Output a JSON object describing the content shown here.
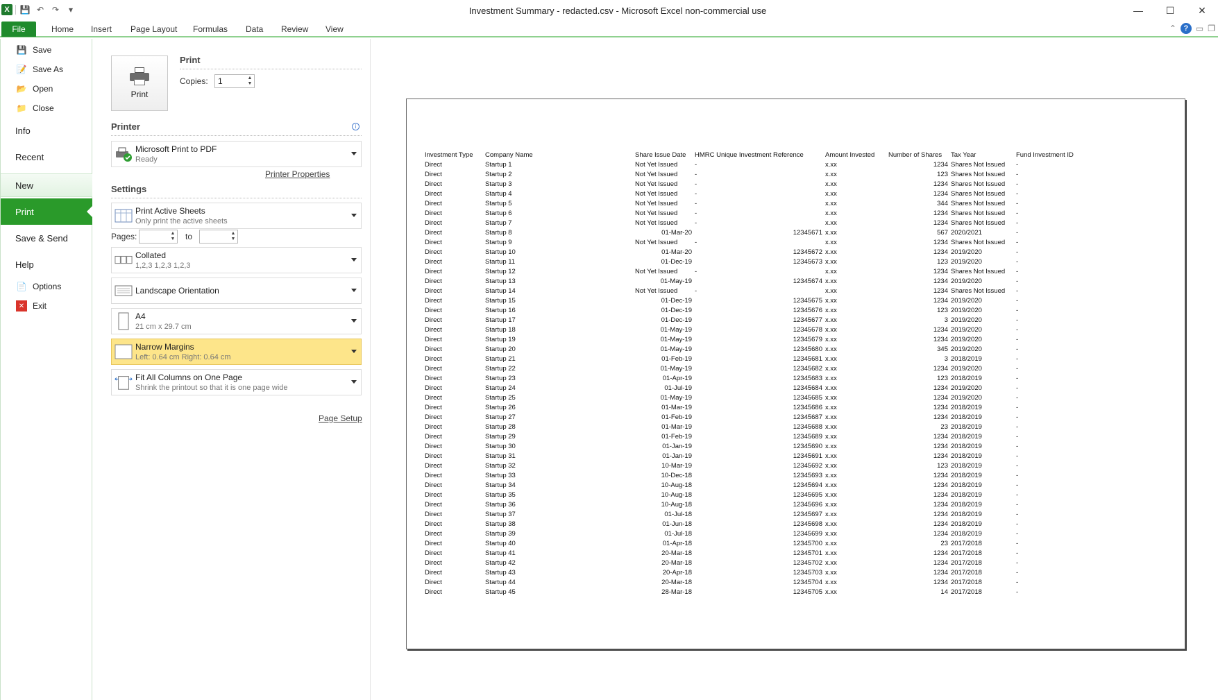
{
  "window": {
    "title": "Investment Summary - redacted.csv  -  Microsoft Excel non-commercial use"
  },
  "ribbon": {
    "tabs": [
      "File",
      "Home",
      "Insert",
      "Page Layout",
      "Formulas",
      "Data",
      "Review",
      "View"
    ]
  },
  "nav": {
    "save": "Save",
    "save_as": "Save As",
    "open": "Open",
    "close": "Close",
    "info": "Info",
    "recent": "Recent",
    "new": "New",
    "print": "Print",
    "save_send": "Save & Send",
    "help": "Help",
    "options": "Options",
    "exit": "Exit"
  },
  "print": {
    "heading": "Print",
    "button_label": "Print",
    "copies_label": "Copies:",
    "copies_value": "1",
    "printer_heading": "Printer",
    "printer_name": "Microsoft Print to PDF",
    "printer_status": "Ready",
    "printer_properties": "Printer Properties",
    "settings_heading": "Settings",
    "sheets_title": "Print Active Sheets",
    "sheets_sub": "Only print the active sheets",
    "pages_label": "Pages:",
    "pages_to": "to",
    "collated_title": "Collated",
    "collated_sub": "1,2,3    1,2,3    1,2,3",
    "orientation_title": "Landscape Orientation",
    "paper_title": "A4",
    "paper_sub": "21 cm x 29.7 cm",
    "margins_title": "Narrow Margins",
    "margins_sub": "Left:  0.64 cm    Right:  0.64 cm",
    "scaling_title": "Fit All Columns on One Page",
    "scaling_sub": "Shrink the printout so that it is one page wide",
    "page_setup": "Page Setup"
  },
  "sheet": {
    "headers": [
      "Investment Type",
      "Company Name",
      "Share Issue Date",
      "HMRC Unique Investment Reference",
      "Amount Invested",
      "Number of Shares",
      "Tax Year",
      "Fund Investment ID"
    ],
    "rows": [
      [
        "Direct",
        "Startup 1",
        "Not Yet Issued",
        "-",
        "",
        "x.xx",
        "1234",
        "Shares Not Issued",
        "-"
      ],
      [
        "Direct",
        "Startup 2",
        "Not Yet Issued",
        "-",
        "",
        "x.xx",
        "123",
        "Shares Not Issued",
        "-"
      ],
      [
        "Direct",
        "Startup 3",
        "Not Yet Issued",
        "-",
        "",
        "x.xx",
        "1234",
        "Shares Not Issued",
        "-"
      ],
      [
        "Direct",
        "Startup 4",
        "Not Yet Issued",
        "-",
        "",
        "x.xx",
        "1234",
        "Shares Not Issued",
        "-"
      ],
      [
        "Direct",
        "Startup 5",
        "Not Yet Issued",
        "-",
        "",
        "x.xx",
        "344",
        "Shares Not Issued",
        "-"
      ],
      [
        "Direct",
        "Startup 6",
        "Not Yet Issued",
        "-",
        "",
        "x.xx",
        "1234",
        "Shares Not Issued",
        "-"
      ],
      [
        "Direct",
        "Startup 7",
        "Not Yet Issued",
        "-",
        "",
        "x.xx",
        "1234",
        "Shares Not Issued",
        "-"
      ],
      [
        "Direct",
        "Startup 8",
        "01-Mar-20",
        "",
        "12345671",
        "x.xx",
        "567",
        "2020/2021",
        "-"
      ],
      [
        "Direct",
        "Startup 9",
        "Not Yet Issued",
        "-",
        "",
        "x.xx",
        "1234",
        "Shares Not Issued",
        "-"
      ],
      [
        "Direct",
        "Startup 10",
        "01-Mar-20",
        "",
        "12345672",
        "x.xx",
        "1234",
        "2019/2020",
        "-"
      ],
      [
        "Direct",
        "Startup 11",
        "01-Dec-19",
        "",
        "12345673",
        "x.xx",
        "123",
        "2019/2020",
        "-"
      ],
      [
        "Direct",
        "Startup 12",
        "Not Yet Issued",
        "-",
        "",
        "x.xx",
        "1234",
        "Shares Not Issued",
        "-"
      ],
      [
        "Direct",
        "Startup 13",
        "01-May-19",
        "",
        "12345674",
        "x.xx",
        "1234",
        "2019/2020",
        "-"
      ],
      [
        "Direct",
        "Startup 14",
        "Not Yet Issued",
        "-",
        "",
        "x.xx",
        "1234",
        "Shares Not Issued",
        "-"
      ],
      [
        "Direct",
        "Startup 15",
        "01-Dec-19",
        "",
        "12345675",
        "x.xx",
        "1234",
        "2019/2020",
        "-"
      ],
      [
        "Direct",
        "Startup 16",
        "01-Dec-19",
        "",
        "12345676",
        "x.xx",
        "123",
        "2019/2020",
        "-"
      ],
      [
        "Direct",
        "Startup 17",
        "01-Dec-19",
        "",
        "12345677",
        "x.xx",
        "3",
        "2019/2020",
        "-"
      ],
      [
        "Direct",
        "Startup 18",
        "01-May-19",
        "",
        "12345678",
        "x.xx",
        "1234",
        "2019/2020",
        "-"
      ],
      [
        "Direct",
        "Startup 19",
        "01-May-19",
        "",
        "12345679",
        "x.xx",
        "1234",
        "2019/2020",
        "-"
      ],
      [
        "Direct",
        "Startup 20",
        "01-May-19",
        "",
        "12345680",
        "x.xx",
        "345",
        "2019/2020",
        "-"
      ],
      [
        "Direct",
        "Startup 21",
        "01-Feb-19",
        "",
        "12345681",
        "x.xx",
        "3",
        "2018/2019",
        "-"
      ],
      [
        "Direct",
        "Startup 22",
        "01-May-19",
        "",
        "12345682",
        "x.xx",
        "1234",
        "2019/2020",
        "-"
      ],
      [
        "Direct",
        "Startup 23",
        "01-Apr-19",
        "",
        "12345683",
        "x.xx",
        "123",
        "2018/2019",
        "-"
      ],
      [
        "Direct",
        "Startup 24",
        "01-Jul-19",
        "",
        "12345684",
        "x.xx",
        "1234",
        "2019/2020",
        "-"
      ],
      [
        "Direct",
        "Startup 25",
        "01-May-19",
        "",
        "12345685",
        "x.xx",
        "1234",
        "2019/2020",
        "-"
      ],
      [
        "Direct",
        "Startup 26",
        "01-Mar-19",
        "",
        "12345686",
        "x.xx",
        "1234",
        "2018/2019",
        "-"
      ],
      [
        "Direct",
        "Startup 27",
        "01-Feb-19",
        "",
        "12345687",
        "x.xx",
        "1234",
        "2018/2019",
        "-"
      ],
      [
        "Direct",
        "Startup 28",
        "01-Mar-19",
        "",
        "12345688",
        "x.xx",
        "23",
        "2018/2019",
        "-"
      ],
      [
        "Direct",
        "Startup 29",
        "01-Feb-19",
        "",
        "12345689",
        "x.xx",
        "1234",
        "2018/2019",
        "-"
      ],
      [
        "Direct",
        "Startup 30",
        "01-Jan-19",
        "",
        "12345690",
        "x.xx",
        "1234",
        "2018/2019",
        "-"
      ],
      [
        "Direct",
        "Startup 31",
        "01-Jan-19",
        "",
        "12345691",
        "x.xx",
        "1234",
        "2018/2019",
        "-"
      ],
      [
        "Direct",
        "Startup 32",
        "10-Mar-19",
        "",
        "12345692",
        "x.xx",
        "123",
        "2018/2019",
        "-"
      ],
      [
        "Direct",
        "Startup 33",
        "10-Dec-18",
        "",
        "12345693",
        "x.xx",
        "1234",
        "2018/2019",
        "-"
      ],
      [
        "Direct",
        "Startup 34",
        "10-Aug-18",
        "",
        "12345694",
        "x.xx",
        "1234",
        "2018/2019",
        "-"
      ],
      [
        "Direct",
        "Startup 35",
        "10-Aug-18",
        "",
        "12345695",
        "x.xx",
        "1234",
        "2018/2019",
        "-"
      ],
      [
        "Direct",
        "Startup 36",
        "10-Aug-18",
        "",
        "12345696",
        "x.xx",
        "1234",
        "2018/2019",
        "-"
      ],
      [
        "Direct",
        "Startup 37",
        "01-Jul-18",
        "",
        "12345697",
        "x.xx",
        "1234",
        "2018/2019",
        "-"
      ],
      [
        "Direct",
        "Startup 38",
        "01-Jun-18",
        "",
        "12345698",
        "x.xx",
        "1234",
        "2018/2019",
        "-"
      ],
      [
        "Direct",
        "Startup 39",
        "01-Jul-18",
        "",
        "12345699",
        "x.xx",
        "1234",
        "2018/2019",
        "-"
      ],
      [
        "Direct",
        "Startup 40",
        "01-Apr-18",
        "",
        "12345700",
        "x.xx",
        "23",
        "2017/2018",
        "-"
      ],
      [
        "Direct",
        "Startup 41",
        "20-Mar-18",
        "",
        "12345701",
        "x.xx",
        "1234",
        "2017/2018",
        "-"
      ],
      [
        "Direct",
        "Startup 42",
        "20-Mar-18",
        "",
        "12345702",
        "x.xx",
        "1234",
        "2017/2018",
        "-"
      ],
      [
        "Direct",
        "Startup 43",
        "20-Apr-18",
        "",
        "12345703",
        "x.xx",
        "1234",
        "2017/2018",
        "-"
      ],
      [
        "Direct",
        "Startup 44",
        "20-Mar-18",
        "",
        "12345704",
        "x.xx",
        "1234",
        "2017/2018",
        "-"
      ],
      [
        "Direct",
        "Startup 45",
        "28-Mar-18",
        "",
        "12345705",
        "x.xx",
        "14",
        "2017/2018",
        "-"
      ]
    ]
  }
}
